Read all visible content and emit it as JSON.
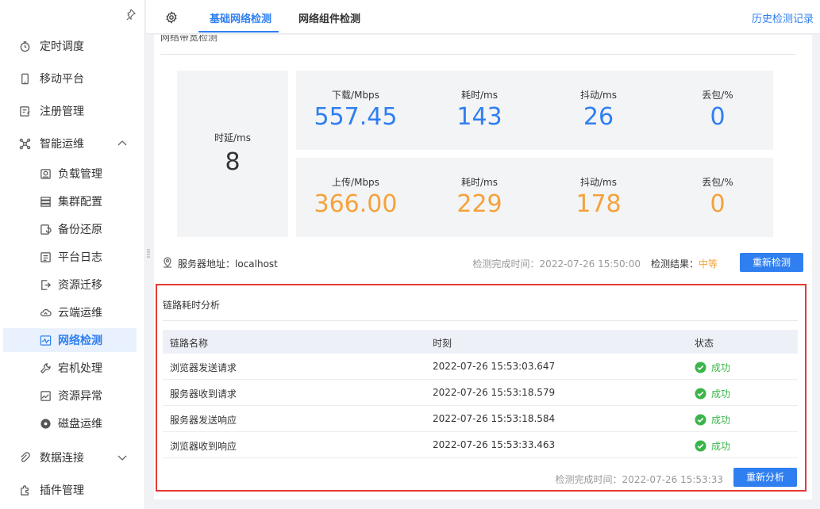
{
  "sidebar": {
    "items": [
      {
        "label": "定时调度",
        "icon": "clock-icon"
      },
      {
        "label": "移动平台",
        "icon": "mobile-icon"
      },
      {
        "label": "注册管理",
        "icon": "register-icon"
      },
      {
        "label": "智能运维",
        "icon": "ops-icon"
      }
    ],
    "sub_items": [
      {
        "label": "负载管理",
        "icon": "load-icon"
      },
      {
        "label": "集群配置",
        "icon": "cluster-icon"
      },
      {
        "label": "备份还原",
        "icon": "backup-icon"
      },
      {
        "label": "平台日志",
        "icon": "log-icon"
      },
      {
        "label": "资源迁移",
        "icon": "migrate-icon"
      },
      {
        "label": "云端运维",
        "icon": "cloud-icon"
      },
      {
        "label": "网络检测",
        "icon": "network-icon"
      },
      {
        "label": "宕机处理",
        "icon": "tool-icon"
      },
      {
        "label": "资源异常",
        "icon": "anomaly-icon"
      },
      {
        "label": "磁盘运维",
        "icon": "disk-icon"
      }
    ],
    "bottom_items": [
      {
        "label": "数据连接",
        "icon": "link-icon"
      },
      {
        "label": "插件管理",
        "icon": "plugin-icon"
      }
    ]
  },
  "tabs": {
    "basic": "基础网络检测",
    "component": "网络组件检测",
    "history": "历史检测记录"
  },
  "panel": {
    "cut_title": "网络带宽检测",
    "latency_label": "时延/ms",
    "latency_value": "8",
    "download": {
      "labels": [
        "下载/Mbps",
        "耗时/ms",
        "抖动/ms",
        "丢包/%"
      ],
      "values": [
        "557.45",
        "143",
        "26",
        "0"
      ]
    },
    "upload": {
      "labels": [
        "上传/Mbps",
        "耗时/ms",
        "抖动/ms",
        "丢包/%"
      ],
      "values": [
        "366.00",
        "229",
        "178",
        "0"
      ]
    },
    "server_label": "服务器地址：localhost",
    "done_time": "检测完成时间：2022-07-26 15:50:00",
    "result_label": "检测结果：",
    "result_value": "中等",
    "retest_button": "重新检测"
  },
  "analysis": {
    "title": "链路耗时分析",
    "columns": [
      "链路名称",
      "时刻",
      "状态"
    ],
    "rows": [
      {
        "name": "浏览器发送请求",
        "time": "2022-07-26 15:53:03.647",
        "status": "成功"
      },
      {
        "name": "服务器收到请求",
        "time": "2022-07-26 15:53:18.579",
        "status": "成功"
      },
      {
        "name": "服务器发送响应",
        "time": "2022-07-26 15:53:18.584",
        "status": "成功"
      },
      {
        "name": "浏览器收到响应",
        "time": "2022-07-26 15:53:33.463",
        "status": "成功"
      }
    ],
    "done_time": "检测完成时间：2022-07-26 15:53:33",
    "reanalyze_button": "重新分析"
  },
  "colors": {
    "accent": "#2f7ff0",
    "orange": "#f5a23b",
    "success": "#3bb54a",
    "highlight_border": "#e53935"
  }
}
